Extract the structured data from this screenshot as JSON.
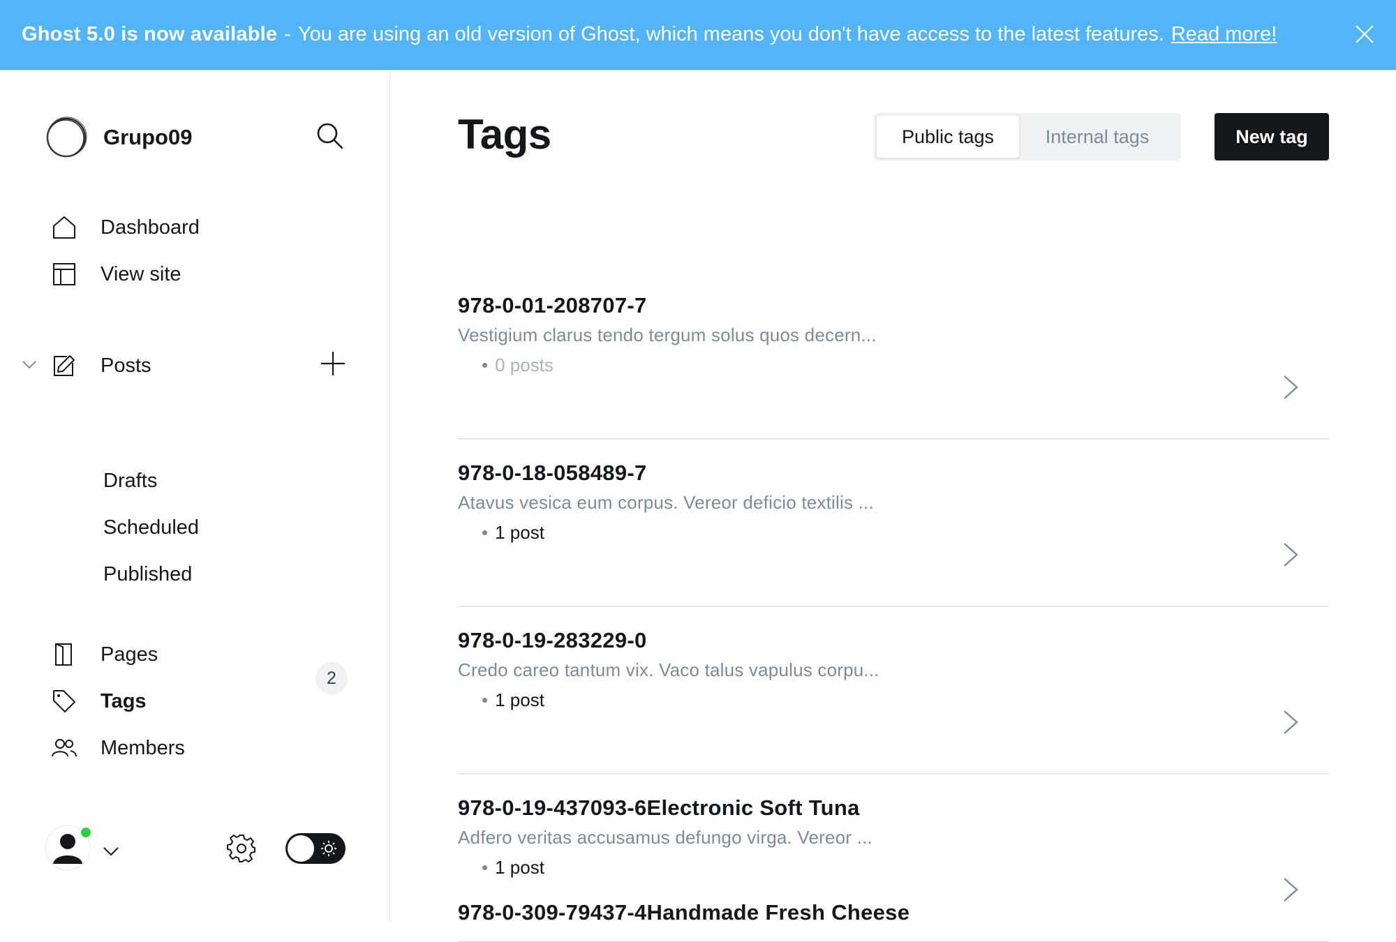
{
  "banner": {
    "strong": "Ghost 5.0 is now available",
    "separator": "-",
    "message": "You are using an old version of Ghost, which means you don't have access to the latest features.",
    "link": "Read more!",
    "close_icon": "close-icon",
    "color": "#53b4f9"
  },
  "sidebar": {
    "site_name": "Grupo09",
    "nav": {
      "dashboard": "Dashboard",
      "view_site": "View site",
      "posts": "Posts",
      "drafts": "Drafts",
      "scheduled": "Scheduled",
      "published": "Published",
      "pages": "Pages",
      "tags": "Tags",
      "members": "Members"
    },
    "members_count": "2",
    "icons": [
      "search-icon",
      "home-icon",
      "layout-icon",
      "edit-icon",
      "plus-icon",
      "page-icon",
      "tag-icon",
      "members-icon",
      "gear-icon",
      "sun-icon"
    ]
  },
  "main": {
    "title": "Tags",
    "tabs": {
      "public": "Public tags",
      "internal": "Internal tags",
      "active": "public"
    },
    "new_tag": "New tag",
    "tags": [
      {
        "name": "978-0-01-208707-7",
        "description": "Vestigium clarus tendo tergum solus quos decern...",
        "count": "0 posts"
      },
      {
        "name": "978-0-18-058489-7",
        "description": "Atavus vesica eum corpus. Vereor deficio textilis ...",
        "count": "1 post"
      },
      {
        "name": "978-0-19-283229-0",
        "description": "Credo careo tantum vix. Vaco talus vapulus corpu...",
        "count": "1 post"
      },
      {
        "name": "978-0-19-437093-6Electronic Soft Tuna",
        "description": "Adfero veritas accusamus defungo virga. Vereor ...",
        "count": "1 post"
      },
      {
        "name": "978-0-309-79437-4Handmade Fresh Cheese"
      }
    ]
  }
}
